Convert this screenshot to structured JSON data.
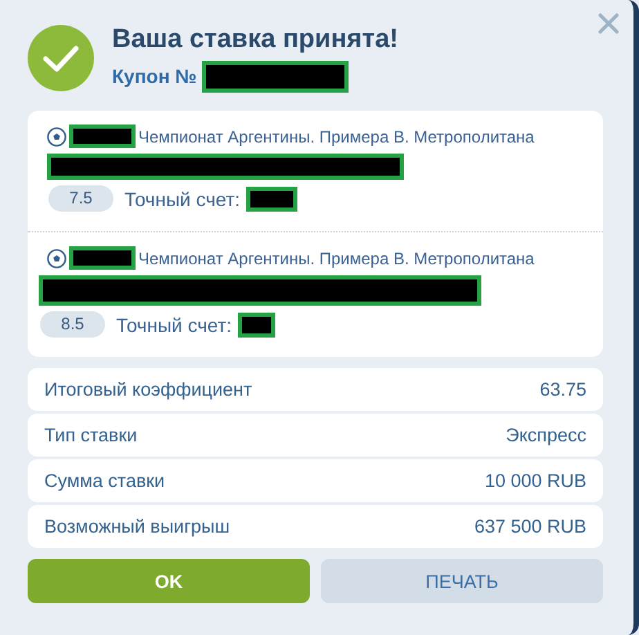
{
  "header": {
    "title": "Ваша ставка принята!",
    "coupon_label": "Купон №"
  },
  "events": [
    {
      "league": "Чемпионат Аргентины. Примера B. Метрополитана",
      "odds": "7.5",
      "bet": "Точный счет:"
    },
    {
      "league": "Чемпионат Аргентины. Примера B. Метрополитана",
      "odds": "8.5",
      "bet": "Точный счет:"
    }
  ],
  "summary": [
    {
      "label": "Итоговый коэффициент",
      "value": "63.75"
    },
    {
      "label": "Тип ставки",
      "value": "Экспресс"
    },
    {
      "label": "Сумма ставки",
      "value": "10 000 RUB"
    },
    {
      "label": "Возможный выигрыш",
      "value": "637 500 RUB"
    }
  ],
  "buttons": [
    {
      "label": "OK",
      "kind": "primary"
    },
    {
      "label": "ПЕЧАТЬ",
      "kind": "secondary"
    }
  ]
}
